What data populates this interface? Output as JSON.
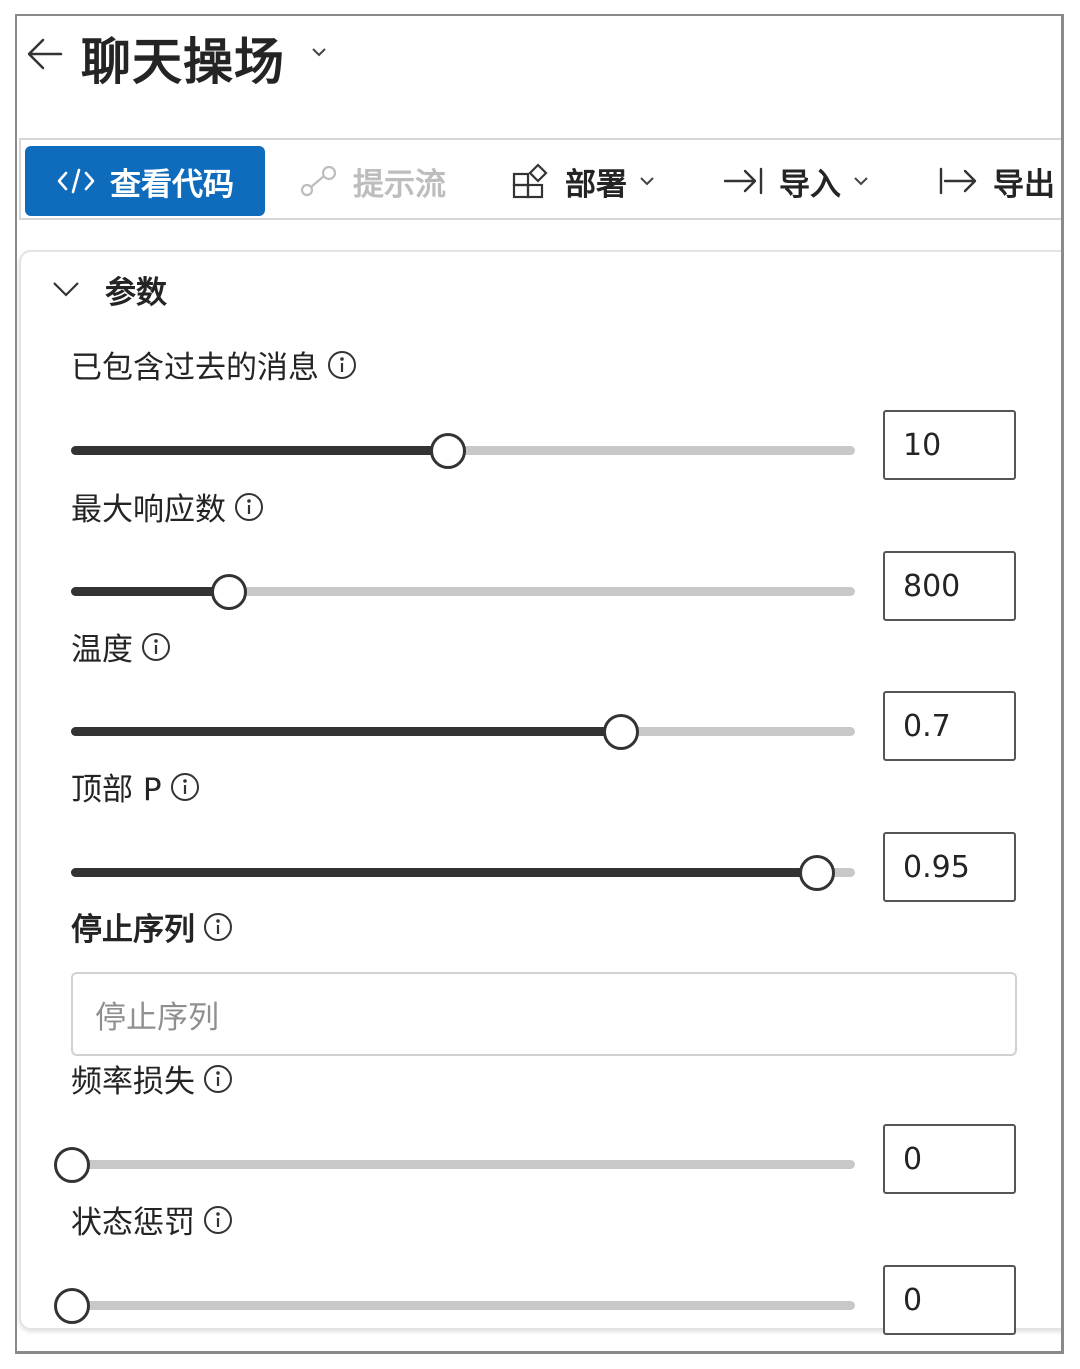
{
  "header": {
    "title": "聊天操场"
  },
  "toolbar": {
    "view_code": "查看代码",
    "prompt_flow": "提示流",
    "deploy": "部署",
    "import": "导入",
    "export": "导出"
  },
  "parameters": {
    "section_title": "参数",
    "past_messages": {
      "label": "已包含过去的消息",
      "value": "10",
      "level": 0.48
    },
    "max_response": {
      "label": "最大响应数",
      "value": "800",
      "level": 0.2
    },
    "temperature": {
      "label": "温度",
      "value": "0.7",
      "level": 0.7
    },
    "top_p": {
      "label": "顶部 P",
      "value": "0.95",
      "level": 0.95
    },
    "stop_sequence": {
      "label": "停止序列",
      "placeholder": "停止序列"
    },
    "frequency_penalty": {
      "label": "频率损失",
      "value": "0",
      "level": 0
    },
    "presence_penalty": {
      "label": "状态惩罚",
      "value": "0",
      "level": 0
    }
  },
  "colors": {
    "accent": "#0f6cbd",
    "slider_fill": "#333333",
    "slider_track": "#c8c8c8"
  }
}
